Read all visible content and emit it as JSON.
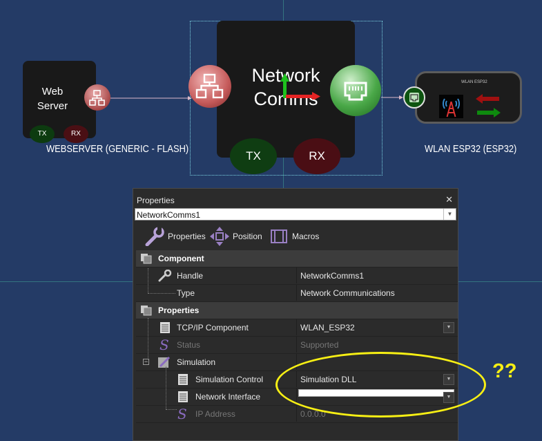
{
  "canvas": {
    "webserver": {
      "title": "Web\nServer",
      "tx": "TX",
      "rx": "RX",
      "label": "WEBSERVER (GENERIC - FLASH)"
    },
    "network_comms": {
      "title": "Network\nComms",
      "tx": "TX",
      "rx": "RX"
    },
    "wlan": {
      "tiny": "WLAN ESP32",
      "label": "WLAN ESP32 (ESP32)"
    }
  },
  "panel": {
    "title": "Properties",
    "close": "✕",
    "selector_value": "NetworkComms1",
    "tabs": {
      "properties": "Properties",
      "position": "Position",
      "macros": "Macros"
    },
    "component_header": "Component",
    "handle_label": "Handle",
    "handle_value": "NetworkComms1",
    "type_label": "Type",
    "type_value": "Network Communications",
    "properties_header": "Properties",
    "tcpip_label": "TCP/IP Component",
    "tcpip_value": "WLAN_ESP32",
    "status_label": "Status",
    "status_value": "Supported",
    "simulation_label": "Simulation",
    "sim_control_label": "Simulation Control",
    "sim_control_value": "Simulation DLL",
    "net_iface_label": "Network Interface",
    "net_iface_value": "",
    "ip_label": "IP Address",
    "ip_value": "0.0.0.0"
  },
  "annotation": {
    "text": "??"
  },
  "colors": {
    "background": "#243b66",
    "annotation": "#f7ef14",
    "panel": "#2b2b2b"
  }
}
